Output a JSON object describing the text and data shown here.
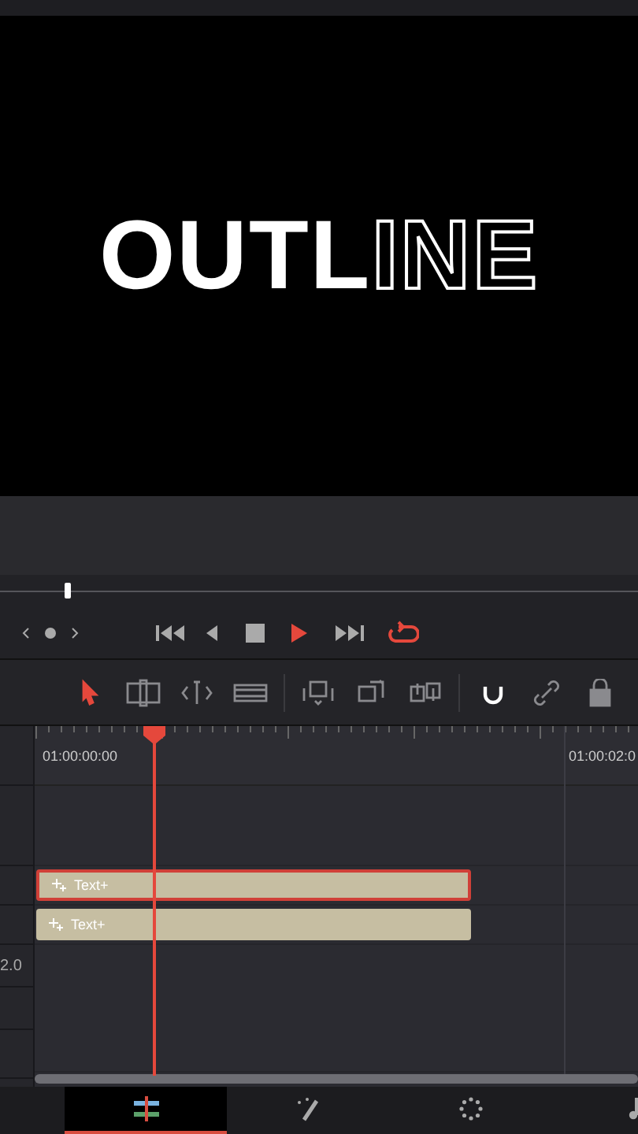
{
  "viewer": {
    "title_parts": [
      {
        "text": "OUTL",
        "kind": "filled"
      },
      {
        "text": "INE",
        "kind": "outline"
      }
    ]
  },
  "scrubber": {
    "level": 0.1
  },
  "transport": {
    "loop_on": true,
    "playing": true
  },
  "tools": [
    {
      "kind": "pointer",
      "selected": true
    },
    {
      "kind": "trim",
      "selected": false
    },
    {
      "kind": "blade",
      "selected": false
    },
    {
      "kind": "filmstrip",
      "selected": false
    },
    {
      "kind": "overwrite",
      "selected": false
    },
    {
      "kind": "replace",
      "selected": false
    },
    {
      "kind": "swap",
      "selected": false
    },
    {
      "kind": "magnet",
      "selected": true
    },
    {
      "kind": "link",
      "selected": false
    },
    {
      "kind": "lock",
      "selected": false
    }
  ],
  "timeline": {
    "timecodes": [
      "01:00:00:00",
      "01:00:02:0"
    ],
    "track_label": "2.0",
    "clips": [
      {
        "label": "Text+",
        "selected": true
      },
      {
        "label": "Text+",
        "selected": false
      }
    ]
  },
  "bottom_tabs": [
    {
      "kind": "edit",
      "selected": true
    },
    {
      "kind": "effects",
      "selected": false
    },
    {
      "kind": "color",
      "selected": false
    },
    {
      "kind": "audio",
      "selected": false
    }
  ]
}
